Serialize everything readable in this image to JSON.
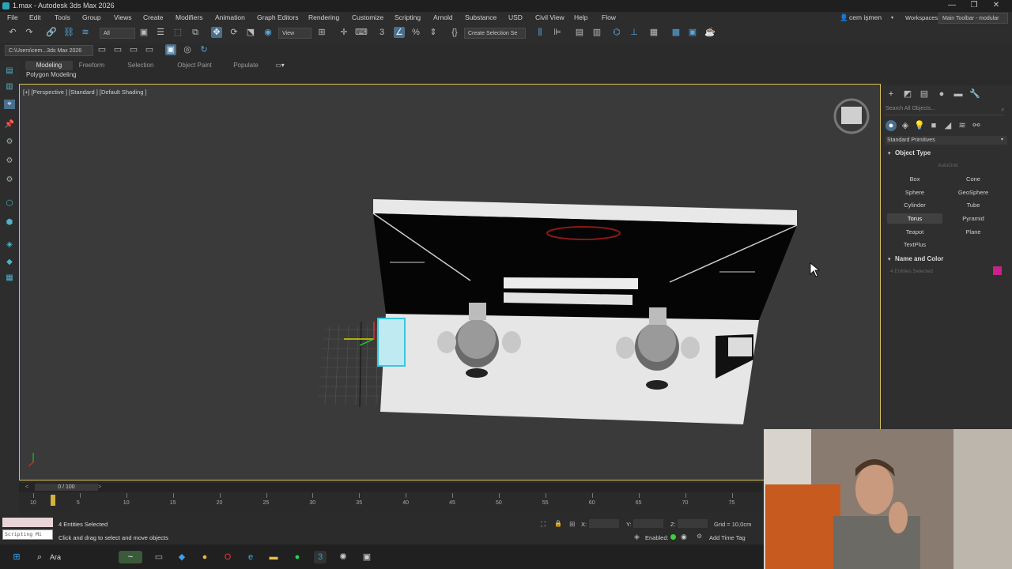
{
  "window": {
    "title": "1.max - Autodesk 3ds Max 2026",
    "minimize": "—",
    "maximize": "❐",
    "close": "✕"
  },
  "menu": [
    "File",
    "Edit",
    "Tools",
    "Group",
    "Views",
    "Create",
    "Modifiers",
    "Animation",
    "Graph Editors",
    "Rendering",
    "Customize",
    "Scripting",
    "Arnold",
    "Substance",
    "USD",
    "Civil View",
    "Help",
    "Flow"
  ],
  "user": {
    "name": "cem işmen"
  },
  "workspaces": {
    "label": "Workspaces:",
    "value": "Main Toolbar - modular"
  },
  "toolbar": {
    "filter_dropdown": "All",
    "view_dropdown": "View",
    "selection_set": "Create Selection Se",
    "path_dropdown": "C:\\Users\\cem...3ds Max 2026"
  },
  "ribbon": {
    "tabs": [
      "Modeling",
      "Freeform",
      "Selection",
      "Object Paint",
      "Populate"
    ],
    "active_tab": "Modeling",
    "panel_label": "Polygon Modeling"
  },
  "viewport": {
    "label": "[+] [Perspective ] [Standard ] [Default Shading ]"
  },
  "command_panel": {
    "search_placeholder": "Search All Objects...",
    "category": "Standard Primitives",
    "object_type_header": "Object Type",
    "autogrid": "AutoGrid",
    "buttons": [
      "Box",
      "Cone",
      "Sphere",
      "GeoSphere",
      "Cylinder",
      "Tube",
      "Torus",
      "Pyramid",
      "Teapot",
      "Plane",
      "TextPlus"
    ],
    "active_button": "Torus",
    "name_color_header": "Name and Color",
    "name_field": "4 Entities Selected",
    "color": "#c7228a"
  },
  "timeline": {
    "frame_readout": "0 / 100",
    "ticks": [
      "10",
      "5",
      "10",
      "15",
      "20",
      "25",
      "30",
      "35",
      "40",
      "45",
      "50",
      "55",
      "60",
      "65",
      "70",
      "75"
    ]
  },
  "status": {
    "script_label": "Scripting Mi",
    "selection": "4 Entities Selected",
    "prompt": "Click and drag to select and move objects",
    "x_label": "X:",
    "y_label": "Y:",
    "z_label": "Z:",
    "grid": "Grid = 10,0cm",
    "enabled_label": "Enabled:",
    "add_time_tag": "Add Time Tag"
  },
  "taskbar": {
    "search": "Ara"
  }
}
